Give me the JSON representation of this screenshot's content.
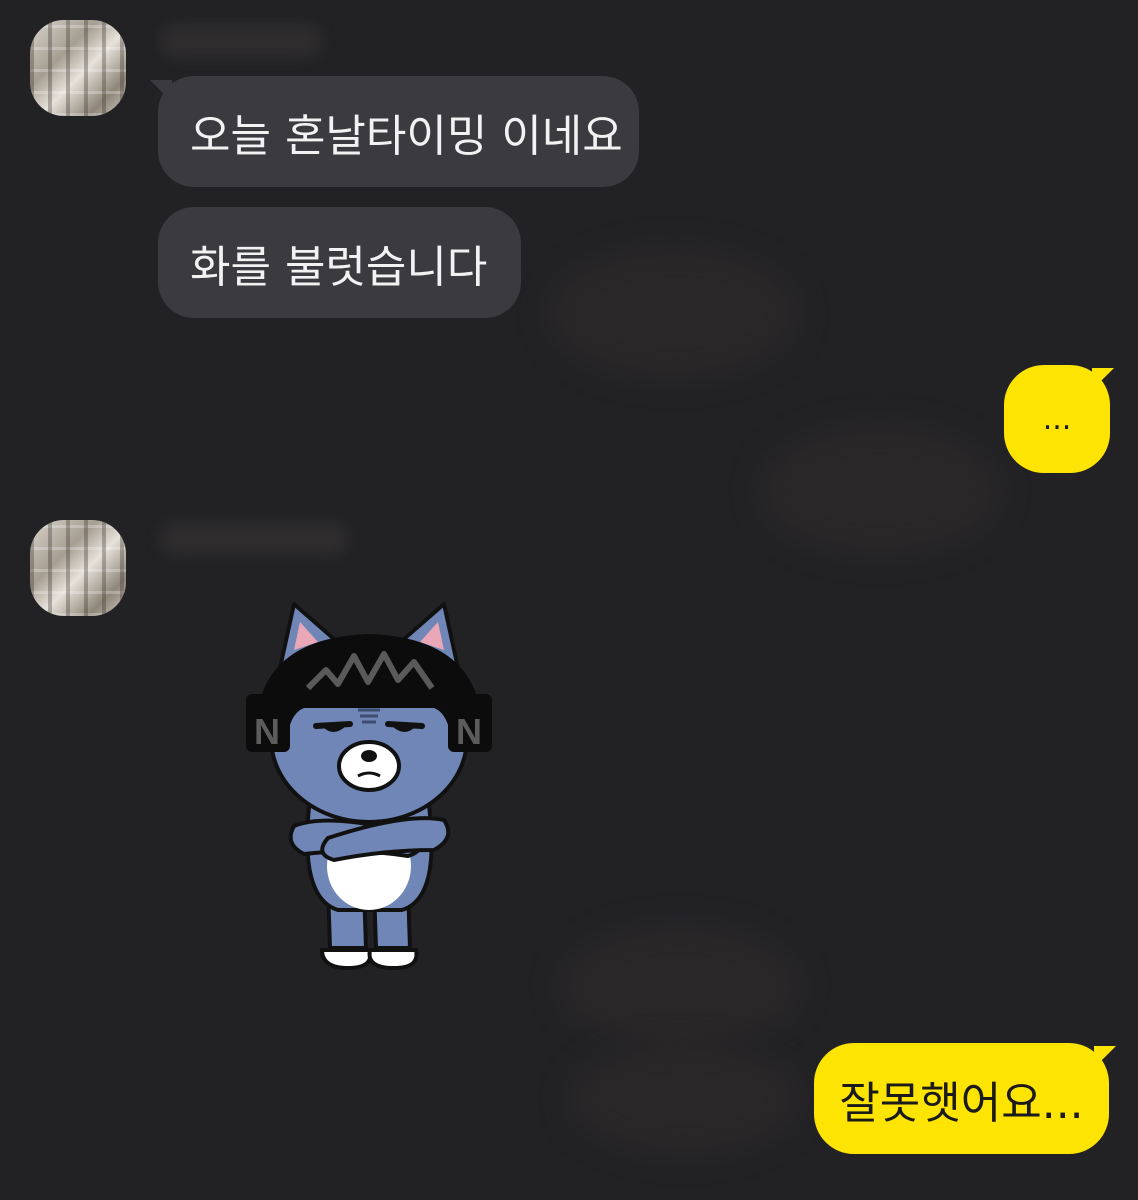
{
  "messages": {
    "received_1": "오늘 혼날타이밍 이네요",
    "received_2": "화를 불럿습니다",
    "sent_1": "...",
    "sent_2": "잘못햇어요..."
  },
  "sticker": {
    "label": "N N",
    "icon": "angry-cat-sticker-icon"
  },
  "colors": {
    "background": "#222225",
    "incoming_bubble": "#3b3a3e",
    "outgoing_bubble": "#fde403"
  }
}
